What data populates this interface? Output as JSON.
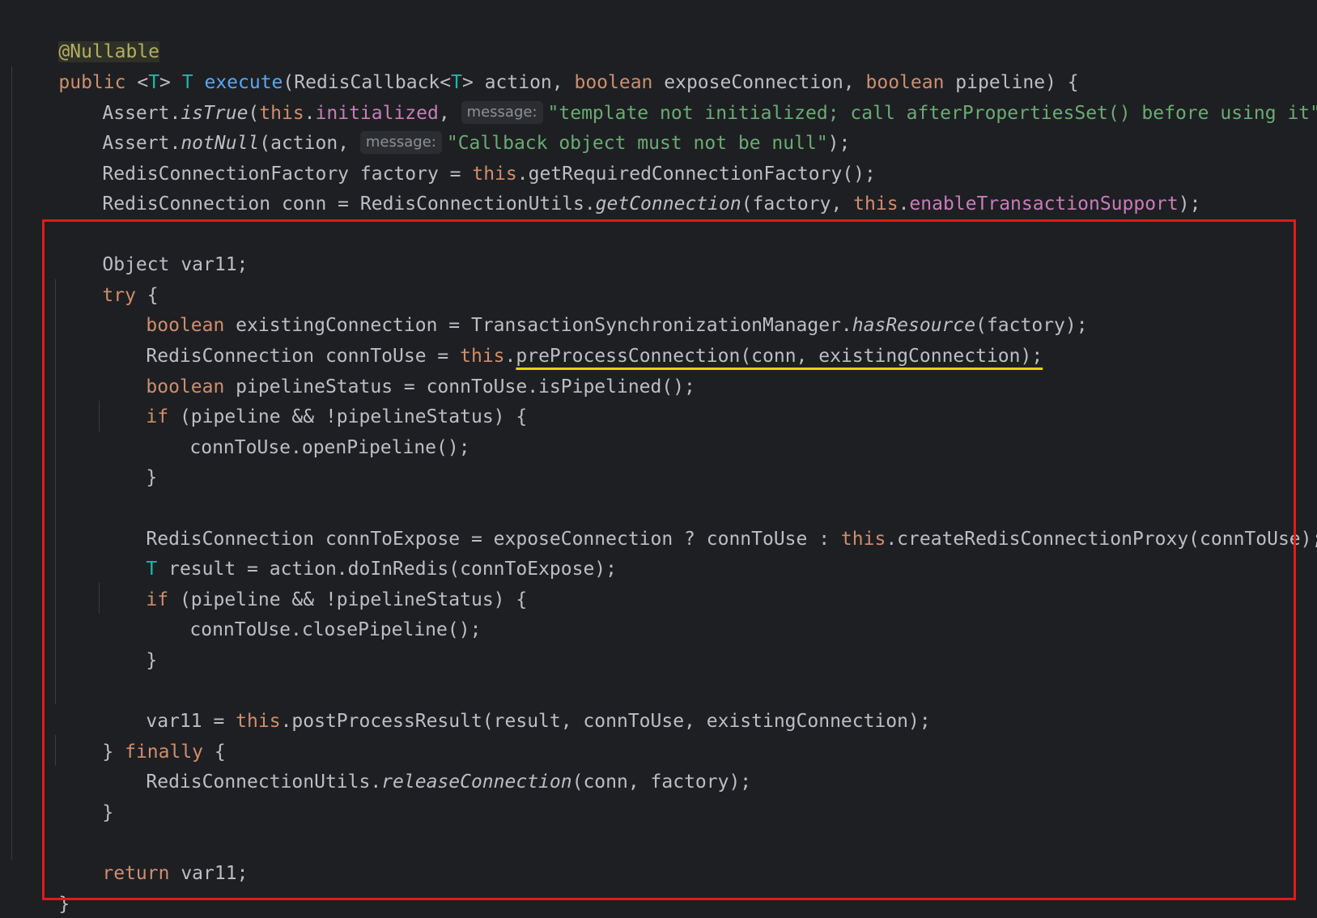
{
  "editor": {
    "annotation": "@Nullable",
    "signature": {
      "kw_public": "public",
      "generic_open": " <",
      "type_t1": "T",
      "generic_close": "> ",
      "type_t2": "T",
      "space1": " ",
      "method": "execute",
      "params_a": "(RedisCallback<",
      "type_t3": "T",
      "params_b": "> action, ",
      "kw_boolean1": "boolean",
      "params_c": " exposeConnection, ",
      "kw_boolean2": "boolean",
      "params_d": " pipeline) {"
    },
    "line_assert_true": {
      "a": "Assert.",
      "method": "isTrue",
      "b": "(",
      "kw_this": "this",
      "dot": ".",
      "field": "initialized",
      "c": ", ",
      "hint": "message:",
      "str": "\"template not initialized; call afterPropertiesSet() before using it\"",
      "d": ");"
    },
    "line_assert_notnull": {
      "a": "Assert.",
      "method": "notNull",
      "b": "(action, ",
      "hint": "message:",
      "str": "\"Callback object must not be null\"",
      "c": ");"
    },
    "line_factory": {
      "a": "RedisConnectionFactory factory = ",
      "kw_this": "this",
      "b": ".getRequiredConnectionFactory();"
    },
    "line_conn": {
      "a": "RedisConnection conn = RedisConnectionUtils.",
      "method": "getConnection",
      "b": "(factory, ",
      "kw_this": "this",
      "dot": ".",
      "field": "enableTransactionSupport",
      "c": ");"
    },
    "line_var11": "Object var11;",
    "line_try": {
      "kw": "try",
      "rest": " {"
    },
    "line_existing": {
      "kw": "boolean",
      "a": " existingConnection = TransactionSynchronizationManager.",
      "method": "hasResource",
      "b": "(factory);"
    },
    "line_conntouse": {
      "a": "RedisConnection connToUse = ",
      "kw_this": "this",
      "dot": ".",
      "underlined": "preProcessConnection(conn, existingConnection);"
    },
    "line_pipelinestatus": {
      "kw": "boolean",
      "a": " pipelineStatus = connToUse.isPipelined();"
    },
    "line_if1": {
      "kw": "if",
      "rest": " (pipeline && !pipelineStatus) {"
    },
    "line_open": "connToUse.openPipeline();",
    "line_close1": "}",
    "line_expose": {
      "a": "RedisConnection connToExpose = exposeConnection ? connToUse : ",
      "kw_this": "this",
      "b": ".createRedisConnectionProxy(connToUse);"
    },
    "line_result": {
      "type": "T",
      "a": " result = action.doInRedis(connToExpose);"
    },
    "line_if2": {
      "kw": "if",
      "rest": " (pipeline && !pipelineStatus) {"
    },
    "line_closepipe": "connToUse.closePipeline();",
    "line_close2": "}",
    "line_post": {
      "a": "var11 = ",
      "kw_this": "this",
      "b": ".postProcessResult(result, connToUse, existingConnection);"
    },
    "line_finally": {
      "a": "} ",
      "kw": "finally",
      "b": " {"
    },
    "line_release": {
      "a": "RedisConnectionUtils.",
      "method": "releaseConnection",
      "b": "(conn, factory);"
    },
    "line_close3": "}",
    "line_return": {
      "kw": "return",
      "rest": " var11;"
    },
    "line_close4": "}"
  },
  "colors": {
    "background": "#1e1f22",
    "keyword": "#cf8e6d",
    "annotation": "#b3ae60",
    "type_param": "#16baac",
    "method_decl": "#56a8f5",
    "string": "#6aab73",
    "field": "#c77dbb",
    "highlight_box": "#e01b1b",
    "underline": "#e5d60b"
  }
}
